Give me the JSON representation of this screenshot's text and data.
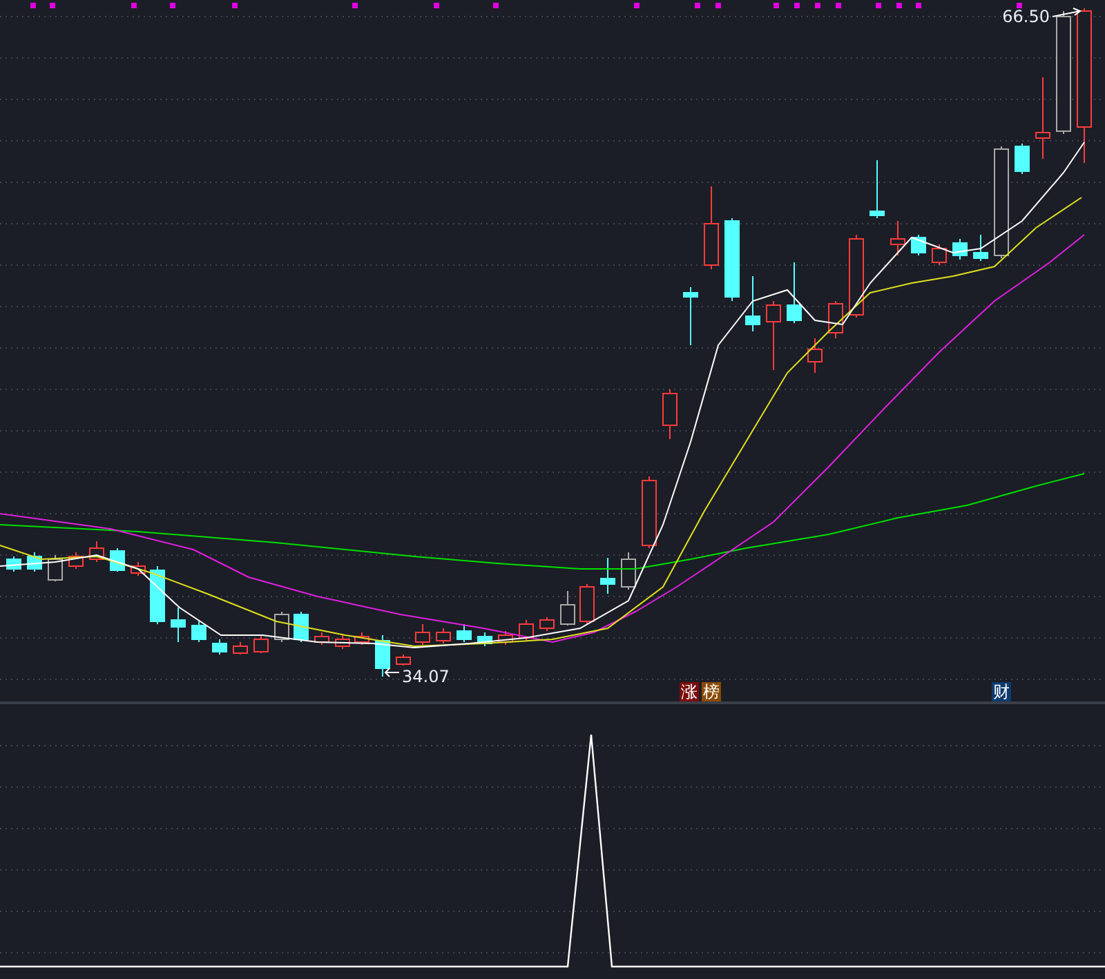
{
  "price_labels": [
    {
      "text": "66.50",
      "kind": "high"
    },
    {
      "text": "34.07",
      "kind": "low"
    }
  ],
  "markers": [
    {
      "text": "涨",
      "color": "#7a0c0c"
    },
    {
      "text": "榜",
      "color": "#8a4a00"
    },
    {
      "text": "财",
      "color": "#0c3a6e"
    }
  ]
}
